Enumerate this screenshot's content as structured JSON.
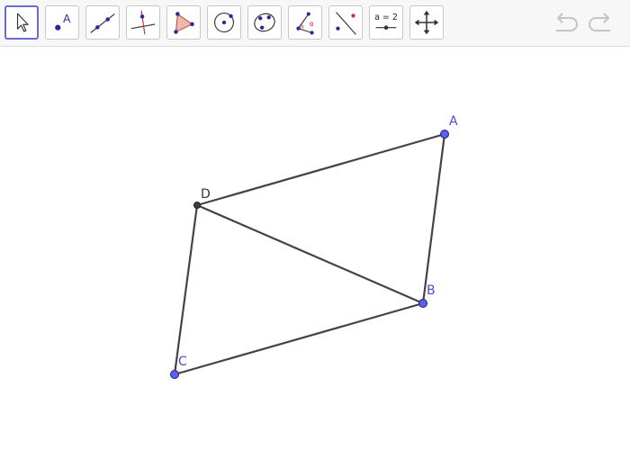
{
  "toolbar": {
    "tools": [
      {
        "name": "move-tool",
        "icon": "cursor-arrow-icon",
        "selected": true
      },
      {
        "name": "point-tool",
        "icon": "point-icon",
        "sample_label": "A"
      },
      {
        "name": "line-tool",
        "icon": "line-icon"
      },
      {
        "name": "perpendicular-line-tool",
        "icon": "perpendicular-line-icon"
      },
      {
        "name": "polygon-tool",
        "icon": "polygon-icon"
      },
      {
        "name": "circle-tool",
        "icon": "circle-icon"
      },
      {
        "name": "conic-tool",
        "icon": "conic-icon"
      },
      {
        "name": "angle-tool",
        "icon": "angle-icon",
        "sample_label": "α"
      },
      {
        "name": "reflect-tool",
        "icon": "reflect-icon"
      },
      {
        "name": "slider-tool",
        "icon": "slider-icon",
        "sample_label": "a = 2"
      },
      {
        "name": "move-graphics-view-tool",
        "icon": "move-view-icon"
      }
    ],
    "undo_icon": "undo-icon",
    "redo_icon": "redo-icon"
  },
  "colors": {
    "free_point": "#5e5ef0",
    "dependent_point": "#404040",
    "segment": "#444444",
    "free_label": "#4a4ad6",
    "dependent_label": "#333333",
    "accent": "#6b6bd6"
  },
  "points": [
    {
      "label": "A",
      "type": "free"
    },
    {
      "label": "B",
      "type": "free"
    },
    {
      "label": "C",
      "type": "free"
    },
    {
      "label": "D",
      "type": "dependent"
    }
  ],
  "segments": [
    {
      "from": "D",
      "to": "A"
    },
    {
      "from": "A",
      "to": "B"
    },
    {
      "from": "B",
      "to": "C"
    },
    {
      "from": "C",
      "to": "D"
    },
    {
      "from": "D",
      "to": "B"
    }
  ]
}
